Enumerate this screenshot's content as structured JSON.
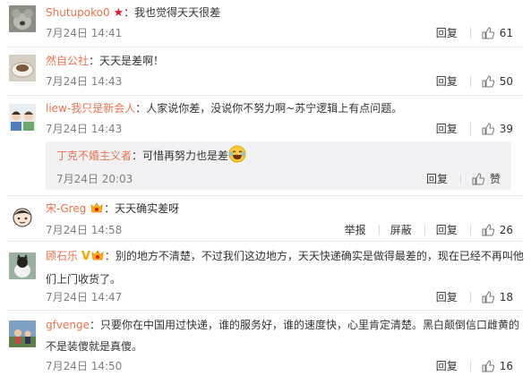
{
  "comments": [
    {
      "user": "Shutupoko0",
      "separator": "：",
      "text": "我也觉得天天很差",
      "time": "7月24日 14:41",
      "reply_label": "回复",
      "likes": "61"
    },
    {
      "user": "然自公社",
      "separator": "：",
      "text": "天天是差啊！",
      "time": "7月24日 14:43",
      "reply_label": "回复",
      "likes": "50"
    },
    {
      "user": "liew-我只是新会人",
      "separator": "：",
      "text": "人家说你差，没说你不努力啊~苏宁逻辑上有点问题。",
      "time": "7月24日 14:43",
      "reply_label": "回复",
      "likes": "39",
      "nested_reply": {
        "user": "丁克不婚主义者",
        "separator": "：",
        "text": "可惜再努力也是差",
        "time": "7月24日 20:03",
        "reply_label": "回复",
        "like_label": "赞"
      }
    },
    {
      "user": "宋-Greg",
      "separator": "：",
      "text": "天天确实差呀",
      "time": "7月24日 14:58",
      "report_label": "举报",
      "block_label": "屏蔽",
      "reply_label": "回复",
      "likes": "26"
    },
    {
      "user": "顾石乐",
      "separator": "：",
      "text": "别的地方不清楚，不过我们这边地方，天天快递确实是做得最差的，现在已经不再叫他们上门收货了。",
      "time": "7月24日 14:47",
      "reply_label": "回复",
      "likes": "18"
    },
    {
      "user": "gfvenge",
      "separator": "：",
      "text": "只要你在中国用过快递，谁的服务好，谁的速度快，心里肯定清楚。黑白颠倒信口雌黄的不是装傻就是真傻。",
      "time": "7月24日 14:50",
      "reply_label": "回复",
      "likes": "16"
    }
  ],
  "colors": {
    "username": "#eb7350",
    "time": "#808080",
    "reply_bg": "#f2f2f5",
    "vip_star": "#e6162d"
  }
}
